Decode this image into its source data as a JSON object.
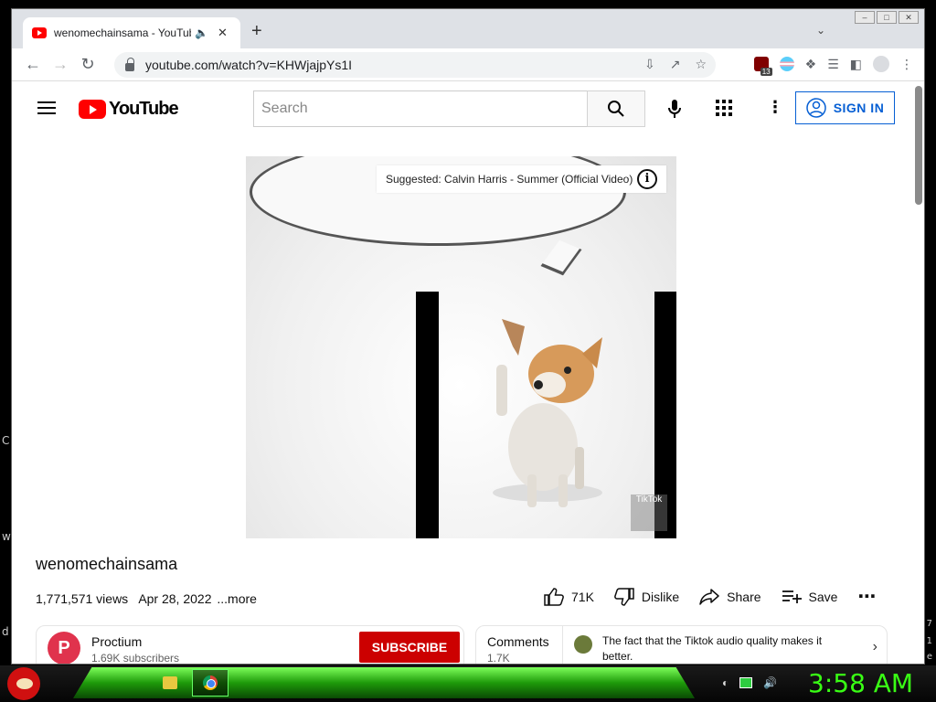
{
  "desktop": {
    "left_fragments": [
      "C",
      "w",
      "d"
    ],
    "right_fragments": [
      "7",
      "1",
      "e"
    ]
  },
  "browser": {
    "tab_title": "wenomechainsama - YouTube",
    "address": "youtube.com/watch?v=KHWjajpYs1I",
    "extension_badge": "13",
    "window_buttons": [
      "–",
      "□",
      "✕"
    ]
  },
  "youtube": {
    "logo_text": "YouTube",
    "search_placeholder": "Search",
    "sign_in_label": "SIGN IN",
    "suggested_card": "Suggested: Calvin Harris - Summer (Official Video)",
    "watermark": "TikTok",
    "video_title": "wenomechainsama",
    "views": "1,771,571 views",
    "date": "Apr 28, 2022",
    "more_label": "...more",
    "actions": {
      "likes": "71K",
      "dislike": "Dislike",
      "share": "Share",
      "save": "Save"
    },
    "channel": {
      "name": "Proctium",
      "subscribers": "1.69K subscribers",
      "avatar_letter": "P",
      "subscribe_label": "SUBSCRIBE"
    },
    "comments": {
      "label": "Comments",
      "count": "1.7K",
      "top_comment": "The fact that the Tiktok audio quality makes it better."
    }
  },
  "taskbar": {
    "clock": "3:58 AM",
    "accent_color": "#39ff14"
  }
}
